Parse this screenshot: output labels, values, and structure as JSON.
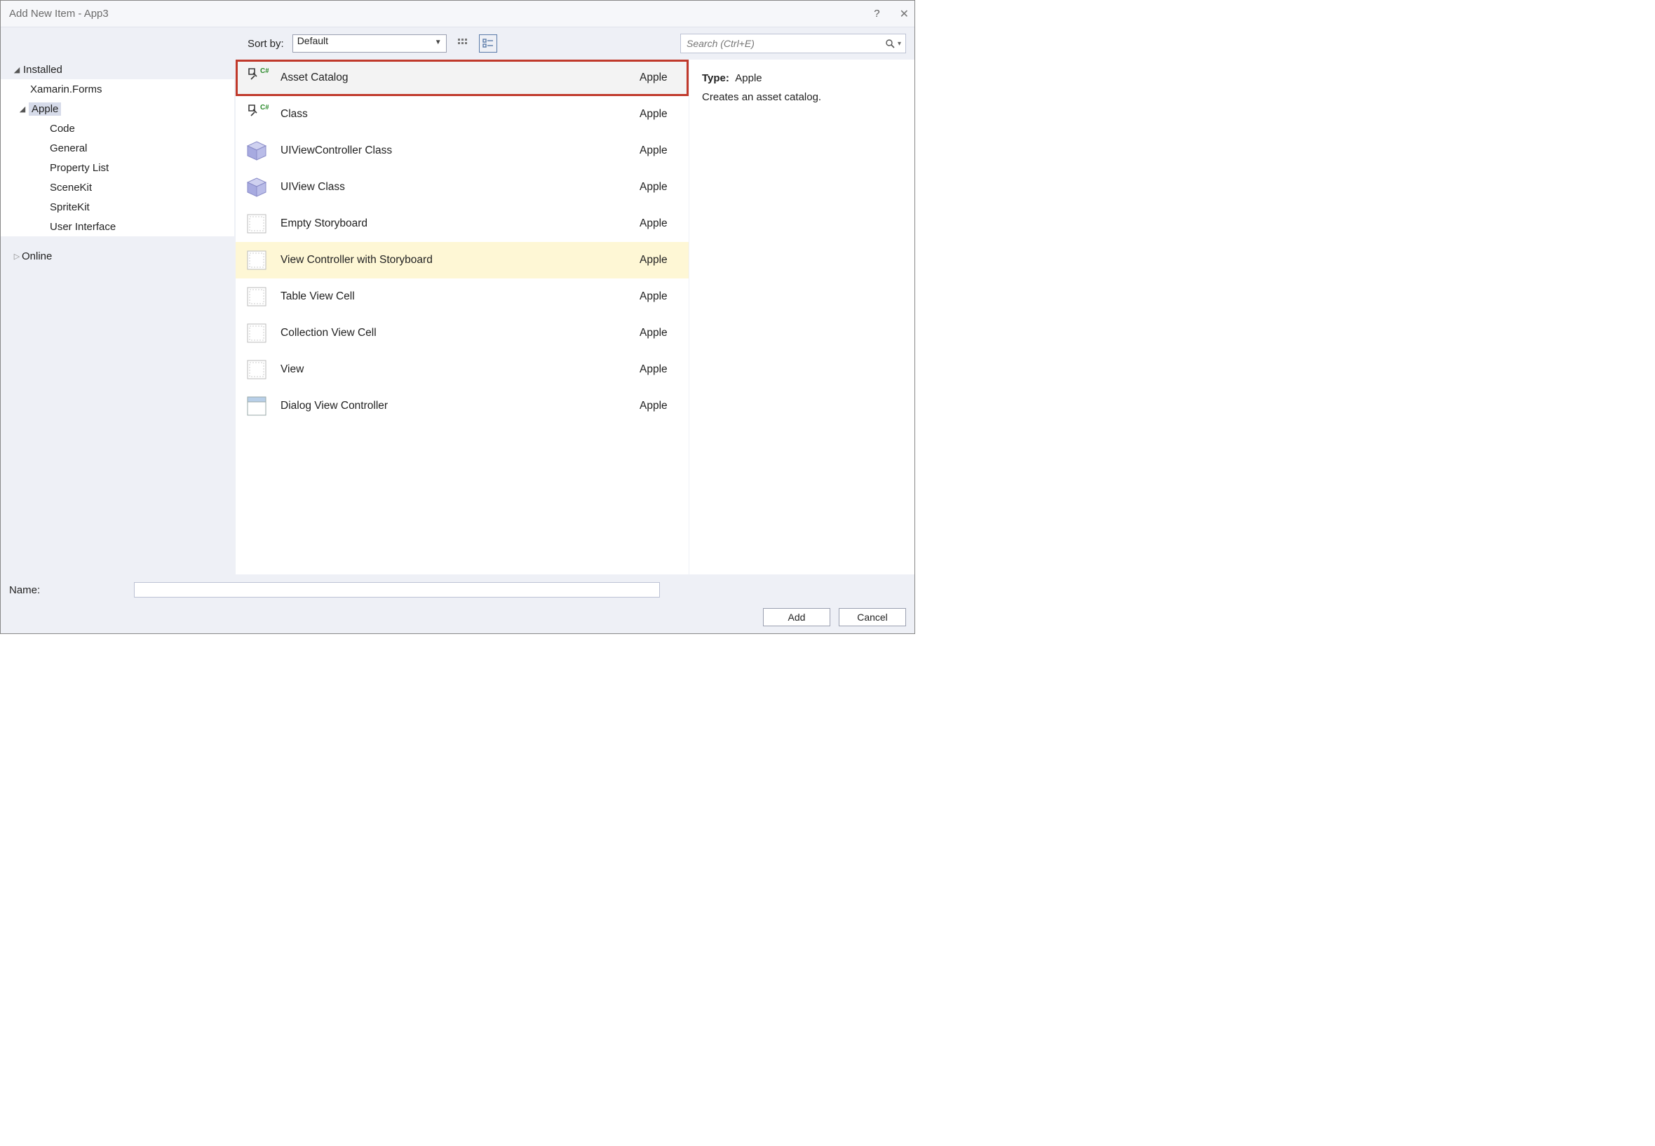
{
  "titlebar": {
    "title": "Add New Item - App3"
  },
  "toolbar": {
    "sortby_label": "Sort by:",
    "sort_value": "Default",
    "search_placeholder": "Search (Ctrl+E)"
  },
  "sidebar": {
    "installed_label": "Installed",
    "online_label": "Online",
    "items": [
      {
        "label": "Xamarin.Forms"
      },
      {
        "label": "Apple"
      },
      {
        "label": "Code"
      },
      {
        "label": "General"
      },
      {
        "label": "Property List"
      },
      {
        "label": "SceneKit"
      },
      {
        "label": "SpriteKit"
      },
      {
        "label": "User Interface"
      }
    ]
  },
  "templates": [
    {
      "label": "Asset Catalog",
      "category": "Apple",
      "icon": "asset"
    },
    {
      "label": "Class",
      "category": "Apple",
      "icon": "asset"
    },
    {
      "label": "UIViewController Class",
      "category": "Apple",
      "icon": "cube"
    },
    {
      "label": "UIView Class",
      "category": "Apple",
      "icon": "cube"
    },
    {
      "label": "Empty Storyboard",
      "category": "Apple",
      "icon": "page"
    },
    {
      "label": "View Controller with Storyboard",
      "category": "Apple",
      "icon": "page"
    },
    {
      "label": "Table View Cell",
      "category": "Apple",
      "icon": "page"
    },
    {
      "label": "Collection View Cell",
      "category": "Apple",
      "icon": "page"
    },
    {
      "label": "View",
      "category": "Apple",
      "icon": "page"
    },
    {
      "label": "Dialog View Controller",
      "category": "Apple",
      "icon": "window"
    }
  ],
  "detail": {
    "type_label": "Type:",
    "type_value": "Apple",
    "description": "Creates an asset catalog."
  },
  "bottom": {
    "name_label": "Name:",
    "name_value": "",
    "add_label": "Add",
    "cancel_label": "Cancel"
  }
}
